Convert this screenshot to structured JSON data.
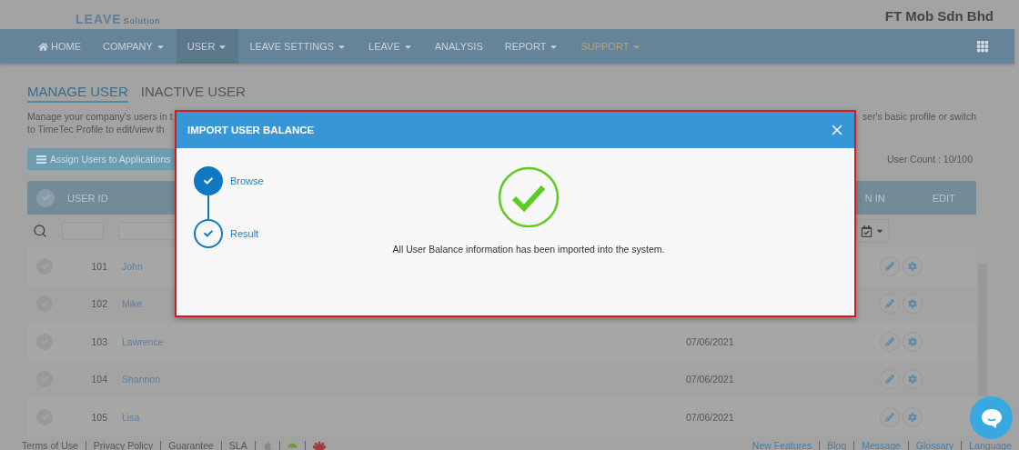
{
  "header": {
    "logo": {
      "word": "LEAVE",
      "tagline": "Solution"
    },
    "company": "FT Mob Sdn Bhd"
  },
  "nav": {
    "items": [
      {
        "label": "HOME",
        "kind": "home",
        "dropdown": false,
        "selected": false
      },
      {
        "label": "COMPANY",
        "kind": "menu",
        "dropdown": true,
        "selected": false
      },
      {
        "label": "USER",
        "kind": "menu",
        "dropdown": true,
        "selected": true
      },
      {
        "label": "LEAVE SETTINGS",
        "kind": "menu",
        "dropdown": true,
        "selected": false
      },
      {
        "label": "LEAVE",
        "kind": "menu",
        "dropdown": true,
        "selected": false
      },
      {
        "label": "ANALYSIS",
        "kind": "menu",
        "dropdown": false,
        "selected": false
      },
      {
        "label": "REPORT",
        "kind": "menu",
        "dropdown": true,
        "selected": false
      },
      {
        "label": "SUPPORT",
        "kind": "accent",
        "dropdown": true,
        "selected": false
      }
    ]
  },
  "tabs": [
    {
      "label": "MANAGE USER",
      "selected": true
    },
    {
      "label": "INACTIVE USER",
      "selected": false
    }
  ],
  "description": {
    "left_lines": [
      "Manage your company's users in t",
      "to TimeTec Profile to edit/view th"
    ],
    "right_line": "ser's basic profile or switch"
  },
  "assign_button": "Assign Users to Applications",
  "user_count": "User Count : 10/100",
  "table": {
    "columns": [
      "USER ID",
      "N IN",
      "EDIT"
    ],
    "all_checked": false,
    "rows": [
      {
        "id": "101",
        "name": "John",
        "checked": false
      },
      {
        "id": "102",
        "name": "Mike",
        "checked": false
      },
      {
        "id": "103",
        "name": "Lawrence",
        "date": "07/06/2021",
        "checked": false
      },
      {
        "id": "104",
        "name": "Shannon",
        "date": "07/06/2021",
        "checked": false
      },
      {
        "id": "105",
        "name": "Lisa",
        "date": "07/06/2021",
        "checked": false
      }
    ]
  },
  "modal": {
    "title": "IMPORT USER BALANCE",
    "steps": [
      {
        "label": "Browse",
        "selected": true
      },
      {
        "label": "Result",
        "selected": false
      }
    ],
    "message": "All User Balance information has been imported into the system."
  },
  "footer": {
    "left_links": [
      "Terms of Use",
      "Privacy Policy",
      "Guarantee",
      "SLA"
    ],
    "right_links": [
      "New Features",
      "Blog",
      "Message",
      "Glossary",
      "Language"
    ]
  }
}
